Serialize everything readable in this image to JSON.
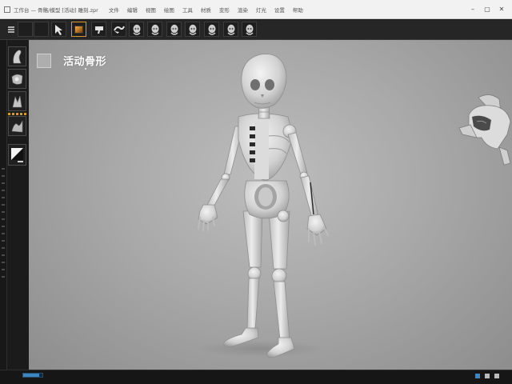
{
  "window": {
    "title": "工作台 — 骨骼/模型 [活动] 雕刻.zpr",
    "controls": [
      "–",
      "▢",
      "✕"
    ]
  },
  "menu": {
    "items": [
      "文件",
      "编辑",
      "视图",
      "绘图",
      "工具",
      "材质",
      "变形",
      "渲染",
      "灯光",
      "设置",
      "帮助"
    ]
  },
  "toolbar": {
    "buttons": [
      {
        "name": "select-tool-button",
        "icon": "pointer-icon"
      },
      {
        "name": "texture-button",
        "icon": "texture-icon"
      },
      {
        "name": "brush-button",
        "icon": "brush-icon"
      },
      {
        "name": "stroke-button",
        "icon": "stroke-icon"
      },
      {
        "name": "head-preset-1-button",
        "icon": "head-icon"
      },
      {
        "name": "head-preset-2-button",
        "icon": "head-icon"
      },
      {
        "name": "head-preset-3-button",
        "icon": "head-icon"
      },
      {
        "name": "head-preset-4-button",
        "icon": "head-icon"
      },
      {
        "name": "head-preset-5-button",
        "icon": "head-icon"
      },
      {
        "name": "head-preset-6-button",
        "icon": "head-icon"
      },
      {
        "name": "head-preset-7-button",
        "icon": "head-icon"
      }
    ]
  },
  "palette": {
    "tools": [
      {
        "name": "tool-standard-brush",
        "icon": "brush-standard-icon"
      },
      {
        "name": "tool-move-brush",
        "icon": "brush-move-icon"
      },
      {
        "name": "tool-clay-brush",
        "icon": "brush-clay-icon"
      },
      {
        "name": "tool-smooth-brush",
        "icon": "brush-smooth-icon"
      },
      {
        "name": "tool-material",
        "icon": "material-icon"
      }
    ]
  },
  "viewport": {
    "title": "活动骨形",
    "model": "skeleton-figure"
  },
  "navigation": {
    "cube_icon": "orientation-helmet-icon"
  },
  "colors": {
    "accent": "#d99a2b",
    "viewport_bg": "#a9a9a9",
    "model": "#d6d6d6",
    "progress": "#3d86c4"
  },
  "status": {
    "progress": 0.85
  }
}
